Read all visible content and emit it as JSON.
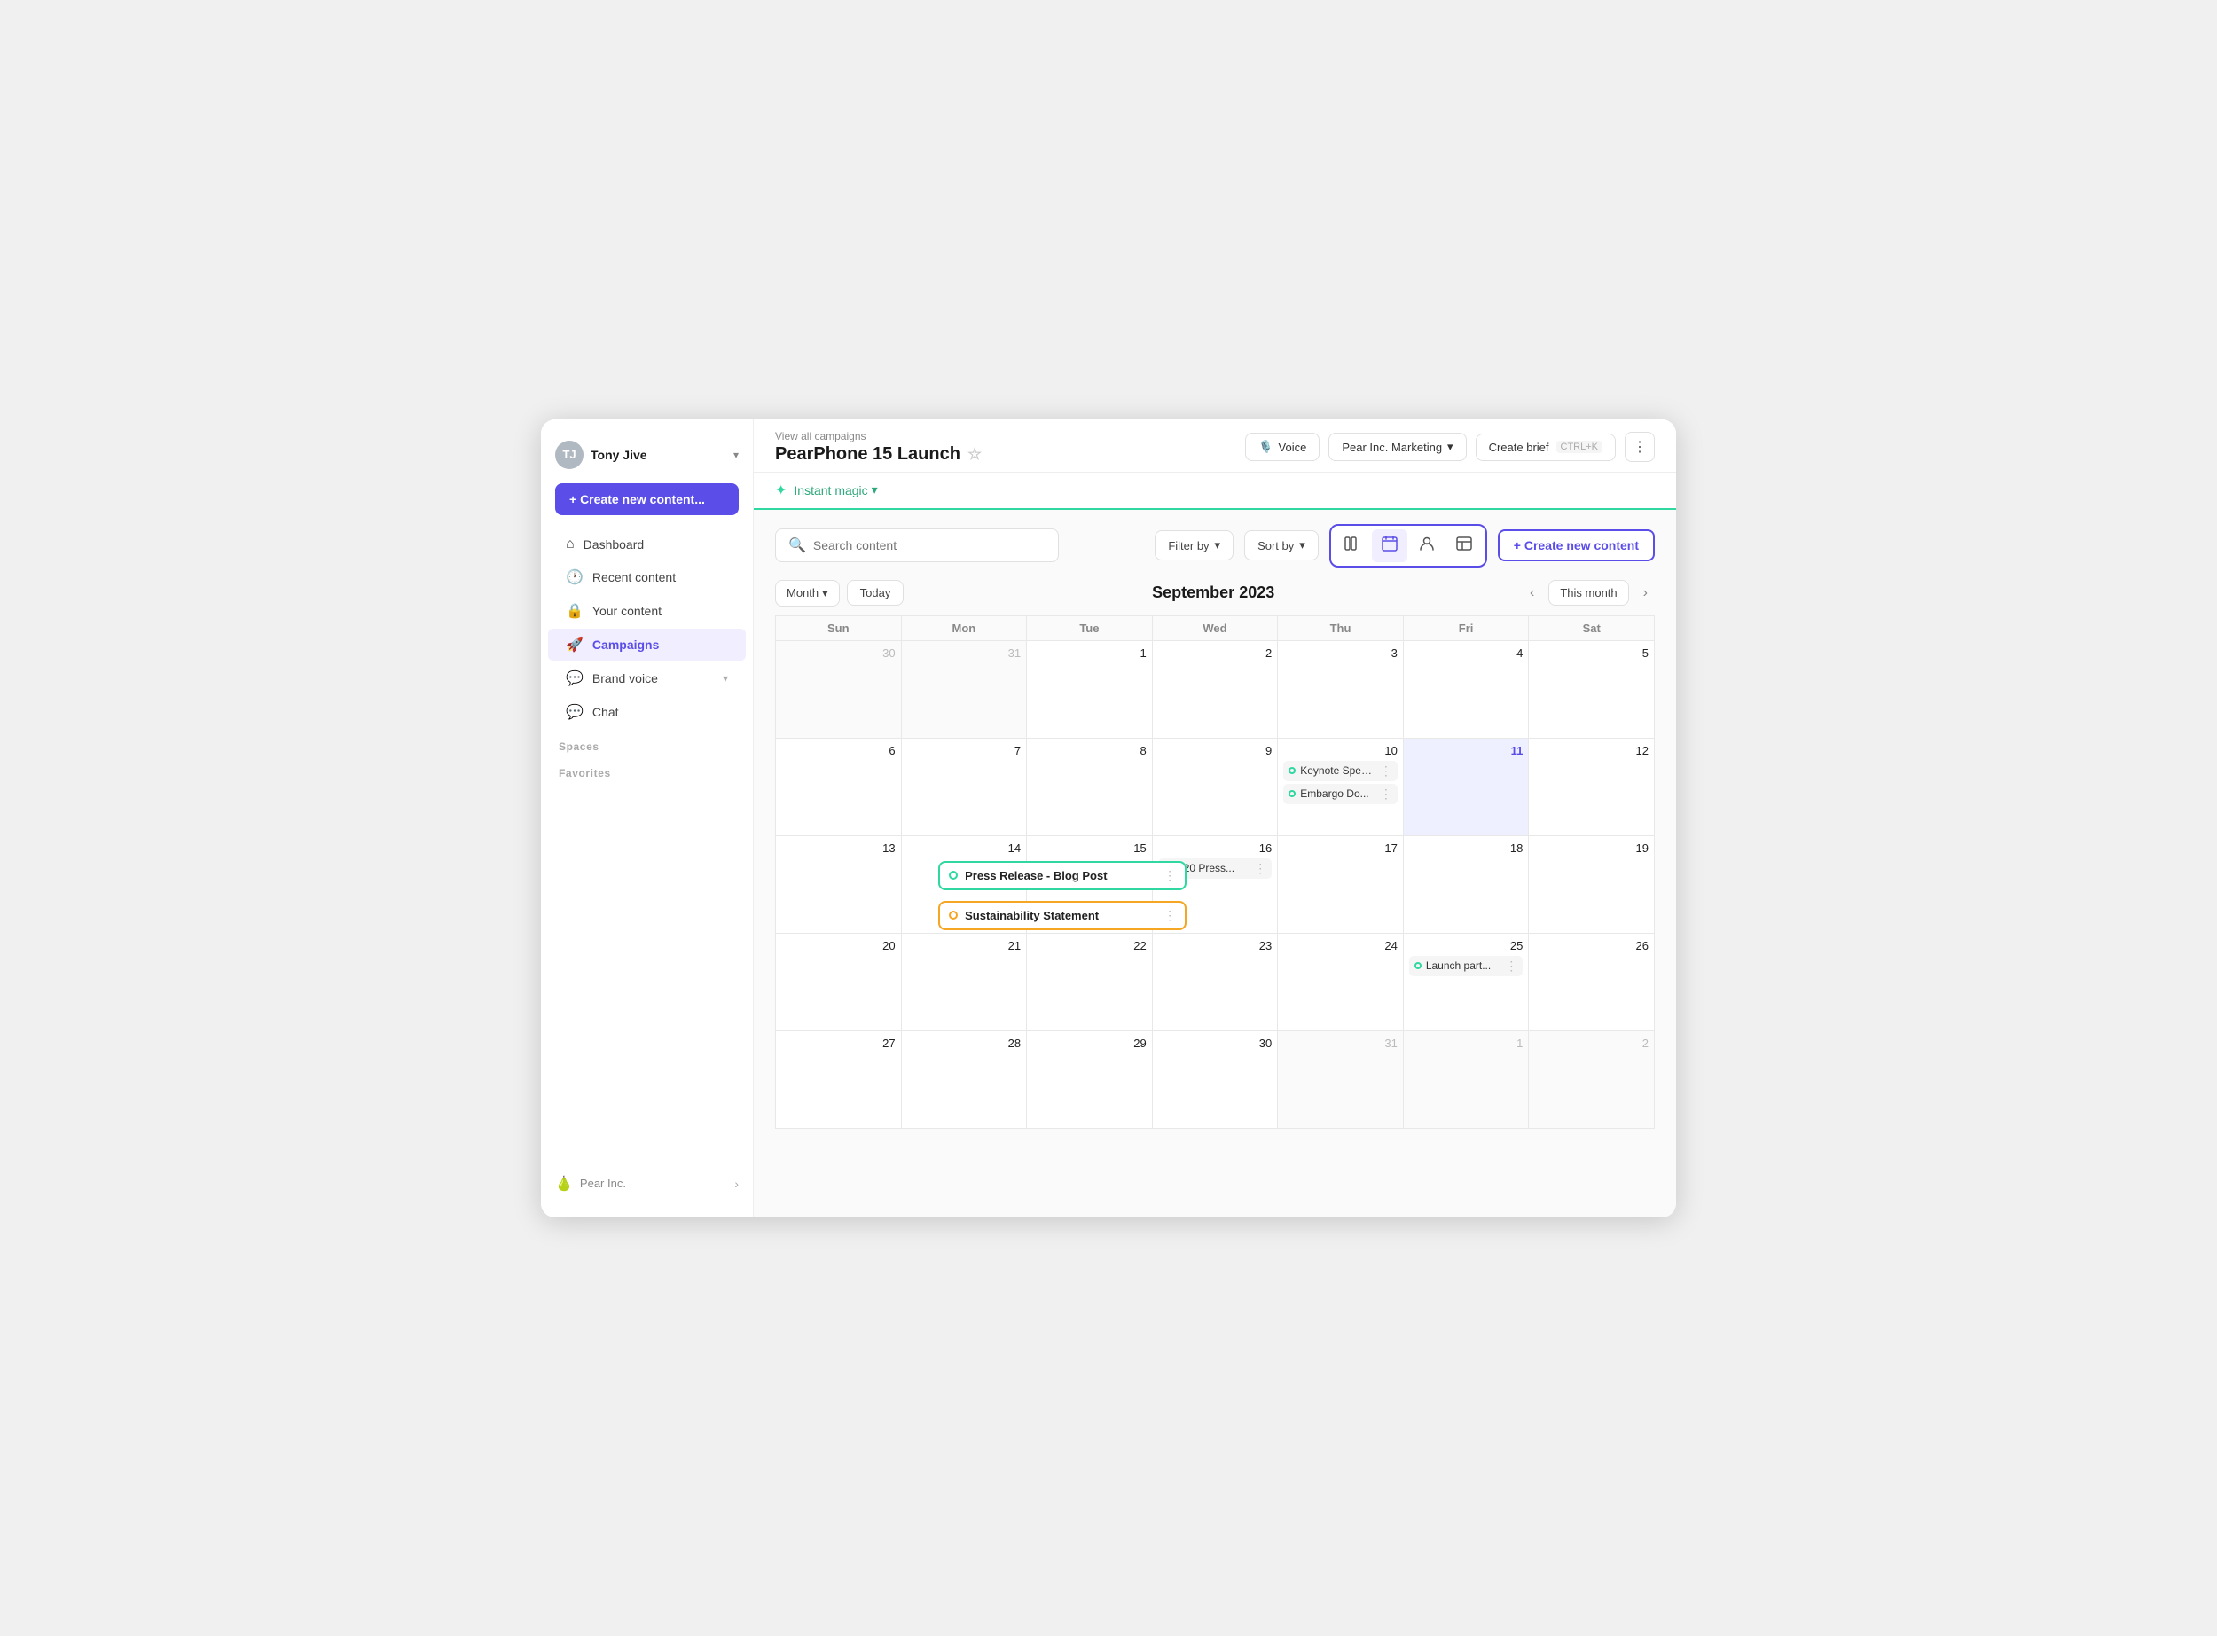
{
  "sidebar": {
    "user": {
      "name": "Tony Jive",
      "initials": "TJ"
    },
    "create_btn": "+ Create new content...",
    "nav_items": [
      {
        "id": "dashboard",
        "label": "Dashboard",
        "icon": "⌂",
        "active": false
      },
      {
        "id": "recent-content",
        "label": "Recent content",
        "icon": "🕐",
        "active": false
      },
      {
        "id": "your-content",
        "label": "Your content",
        "icon": "🔒",
        "active": false
      },
      {
        "id": "campaigns",
        "label": "Campaigns",
        "icon": "🚀",
        "active": true
      },
      {
        "id": "brand-voice",
        "label": "Brand voice",
        "icon": "💬",
        "active": false
      },
      {
        "id": "chat",
        "label": "Chat",
        "icon": "💬",
        "active": false
      }
    ],
    "spaces_label": "Spaces",
    "favorites_label": "Favorites",
    "footer": {
      "label": "Pear Inc.",
      "icon": "🍐"
    }
  },
  "topbar": {
    "breadcrumb": "View all campaigns",
    "title": "PearPhone 15 Launch",
    "voice_label": "Voice",
    "org_label": "Pear Inc. Marketing",
    "create_brief_label": "Create brief",
    "shortcut": "CTRL+K"
  },
  "magic_bar": {
    "label": "Instant magic"
  },
  "toolbar": {
    "search_placeholder": "Search content",
    "filter_label": "Filter by",
    "sort_label": "Sort by",
    "create_new_label": "+ Create new content"
  },
  "calendar_nav": {
    "month_label": "Month",
    "today_label": "Today",
    "title": "September 2023",
    "this_month_label": "This month"
  },
  "calendar": {
    "days": [
      "Sun",
      "Mon",
      "Tue",
      "Wed",
      "Thu",
      "Fri",
      "Sat"
    ],
    "weeks": [
      [
        {
          "num": "30",
          "other": true,
          "events": []
        },
        {
          "num": "31",
          "other": true,
          "events": []
        },
        {
          "num": "1",
          "events": []
        },
        {
          "num": "2",
          "events": []
        },
        {
          "num": "3",
          "events": []
        },
        {
          "num": "4",
          "events": []
        },
        {
          "num": "5",
          "events": []
        }
      ],
      [
        {
          "num": "6",
          "events": []
        },
        {
          "num": "7",
          "events": []
        },
        {
          "num": "8",
          "events": []
        },
        {
          "num": "9",
          "events": []
        },
        {
          "num": "10",
          "today": false,
          "events": [
            {
              "label": "Keynote Speech",
              "dot": "green"
            },
            {
              "label": "Embargo Do...",
              "dot": "green"
            }
          ]
        },
        {
          "num": "11",
          "blue": true,
          "today": true,
          "events": []
        },
        {
          "num": "12",
          "events": []
        }
      ],
      [
        {
          "num": "13",
          "events": []
        },
        {
          "num": "14",
          "events": []
        },
        {
          "num": "15",
          "events": []
        },
        {
          "num": "16",
          "events": [
            {
              "label": "9/20 Press...",
              "dot": "green"
            }
          ]
        },
        {
          "num": "17",
          "events": []
        },
        {
          "num": "18",
          "events": []
        },
        {
          "num": "19",
          "events": []
        }
      ],
      [
        {
          "num": "20",
          "events": []
        },
        {
          "num": "21",
          "events": []
        },
        {
          "num": "22",
          "events": []
        },
        {
          "num": "23",
          "events": []
        },
        {
          "num": "24",
          "events": []
        },
        {
          "num": "25",
          "events": [
            {
              "label": "Launch part...",
              "dot": "green"
            }
          ]
        },
        {
          "num": "26",
          "events": []
        }
      ],
      [
        {
          "num": "27",
          "events": []
        },
        {
          "num": "28",
          "events": []
        },
        {
          "num": "29",
          "events": []
        },
        {
          "num": "30",
          "events": []
        },
        {
          "num": "31",
          "other": true,
          "events": []
        },
        {
          "num": "1",
          "other": true,
          "events": []
        },
        {
          "num": "2",
          "other": true,
          "events": []
        }
      ]
    ],
    "overlay_events": [
      {
        "label": "Press Release - Blog Post",
        "dot": "green",
        "type": "green"
      },
      {
        "label": "Sustainability Statement",
        "dot": "yellow",
        "type": "yellow"
      }
    ]
  }
}
